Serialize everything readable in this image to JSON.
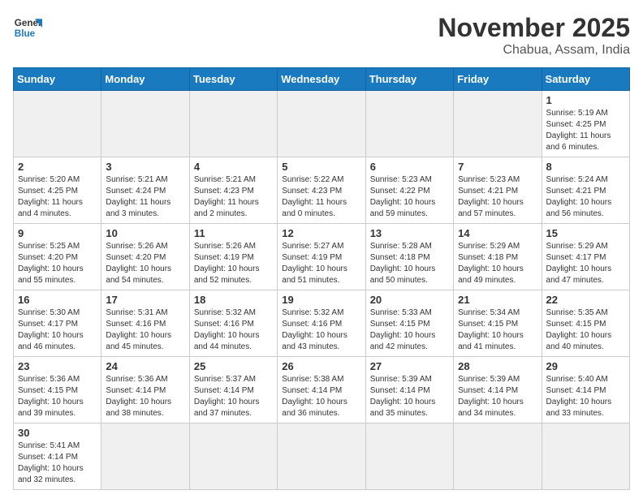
{
  "header": {
    "logo_general": "General",
    "logo_blue": "Blue",
    "month_title": "November 2025",
    "location": "Chabua, Assam, India"
  },
  "days_of_week": [
    "Sunday",
    "Monday",
    "Tuesday",
    "Wednesday",
    "Thursday",
    "Friday",
    "Saturday"
  ],
  "weeks": [
    [
      {
        "day": "",
        "info": ""
      },
      {
        "day": "",
        "info": ""
      },
      {
        "day": "",
        "info": ""
      },
      {
        "day": "",
        "info": ""
      },
      {
        "day": "",
        "info": ""
      },
      {
        "day": "",
        "info": ""
      },
      {
        "day": "1",
        "info": "Sunrise: 5:19 AM\nSunset: 4:25 PM\nDaylight: 11 hours and 6 minutes."
      }
    ],
    [
      {
        "day": "2",
        "info": "Sunrise: 5:20 AM\nSunset: 4:25 PM\nDaylight: 11 hours and 4 minutes."
      },
      {
        "day": "3",
        "info": "Sunrise: 5:21 AM\nSunset: 4:24 PM\nDaylight: 11 hours and 3 minutes."
      },
      {
        "day": "4",
        "info": "Sunrise: 5:21 AM\nSunset: 4:23 PM\nDaylight: 11 hours and 2 minutes."
      },
      {
        "day": "5",
        "info": "Sunrise: 5:22 AM\nSunset: 4:23 PM\nDaylight: 11 hours and 0 minutes."
      },
      {
        "day": "6",
        "info": "Sunrise: 5:23 AM\nSunset: 4:22 PM\nDaylight: 10 hours and 59 minutes."
      },
      {
        "day": "7",
        "info": "Sunrise: 5:23 AM\nSunset: 4:21 PM\nDaylight: 10 hours and 57 minutes."
      },
      {
        "day": "8",
        "info": "Sunrise: 5:24 AM\nSunset: 4:21 PM\nDaylight: 10 hours and 56 minutes."
      }
    ],
    [
      {
        "day": "9",
        "info": "Sunrise: 5:25 AM\nSunset: 4:20 PM\nDaylight: 10 hours and 55 minutes."
      },
      {
        "day": "10",
        "info": "Sunrise: 5:26 AM\nSunset: 4:20 PM\nDaylight: 10 hours and 54 minutes."
      },
      {
        "day": "11",
        "info": "Sunrise: 5:26 AM\nSunset: 4:19 PM\nDaylight: 10 hours and 52 minutes."
      },
      {
        "day": "12",
        "info": "Sunrise: 5:27 AM\nSunset: 4:19 PM\nDaylight: 10 hours and 51 minutes."
      },
      {
        "day": "13",
        "info": "Sunrise: 5:28 AM\nSunset: 4:18 PM\nDaylight: 10 hours and 50 minutes."
      },
      {
        "day": "14",
        "info": "Sunrise: 5:29 AM\nSunset: 4:18 PM\nDaylight: 10 hours and 49 minutes."
      },
      {
        "day": "15",
        "info": "Sunrise: 5:29 AM\nSunset: 4:17 PM\nDaylight: 10 hours and 47 minutes."
      }
    ],
    [
      {
        "day": "16",
        "info": "Sunrise: 5:30 AM\nSunset: 4:17 PM\nDaylight: 10 hours and 46 minutes."
      },
      {
        "day": "17",
        "info": "Sunrise: 5:31 AM\nSunset: 4:16 PM\nDaylight: 10 hours and 45 minutes."
      },
      {
        "day": "18",
        "info": "Sunrise: 5:32 AM\nSunset: 4:16 PM\nDaylight: 10 hours and 44 minutes."
      },
      {
        "day": "19",
        "info": "Sunrise: 5:32 AM\nSunset: 4:16 PM\nDaylight: 10 hours and 43 minutes."
      },
      {
        "day": "20",
        "info": "Sunrise: 5:33 AM\nSunset: 4:15 PM\nDaylight: 10 hours and 42 minutes."
      },
      {
        "day": "21",
        "info": "Sunrise: 5:34 AM\nSunset: 4:15 PM\nDaylight: 10 hours and 41 minutes."
      },
      {
        "day": "22",
        "info": "Sunrise: 5:35 AM\nSunset: 4:15 PM\nDaylight: 10 hours and 40 minutes."
      }
    ],
    [
      {
        "day": "23",
        "info": "Sunrise: 5:36 AM\nSunset: 4:15 PM\nDaylight: 10 hours and 39 minutes."
      },
      {
        "day": "24",
        "info": "Sunrise: 5:36 AM\nSunset: 4:14 PM\nDaylight: 10 hours and 38 minutes."
      },
      {
        "day": "25",
        "info": "Sunrise: 5:37 AM\nSunset: 4:14 PM\nDaylight: 10 hours and 37 minutes."
      },
      {
        "day": "26",
        "info": "Sunrise: 5:38 AM\nSunset: 4:14 PM\nDaylight: 10 hours and 36 minutes."
      },
      {
        "day": "27",
        "info": "Sunrise: 5:39 AM\nSunset: 4:14 PM\nDaylight: 10 hours and 35 minutes."
      },
      {
        "day": "28",
        "info": "Sunrise: 5:39 AM\nSunset: 4:14 PM\nDaylight: 10 hours and 34 minutes."
      },
      {
        "day": "29",
        "info": "Sunrise: 5:40 AM\nSunset: 4:14 PM\nDaylight: 10 hours and 33 minutes."
      }
    ],
    [
      {
        "day": "30",
        "info": "Sunrise: 5:41 AM\nSunset: 4:14 PM\nDaylight: 10 hours and 32 minutes."
      },
      {
        "day": "",
        "info": ""
      },
      {
        "day": "",
        "info": ""
      },
      {
        "day": "",
        "info": ""
      },
      {
        "day": "",
        "info": ""
      },
      {
        "day": "",
        "info": ""
      },
      {
        "day": "",
        "info": ""
      }
    ]
  ]
}
